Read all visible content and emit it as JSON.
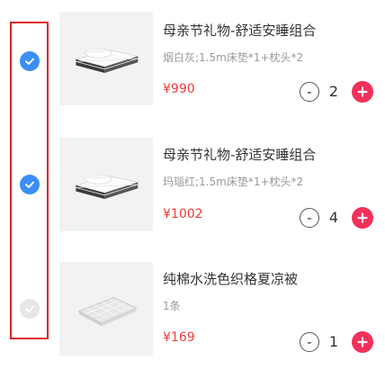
{
  "colors": {
    "accent_check": "#3a8ef6",
    "price": "#f23a3a",
    "plus_button": "#f2305a",
    "highlight_border": "#e02020"
  },
  "icons": {
    "check": "check-icon",
    "minus": "minus-icon",
    "plus": "plus-icon"
  },
  "cart": {
    "items": [
      {
        "title": "母亲节礼物-舒适安睡组合",
        "spec": "烟白灰;1.5m床垫*1+枕头*2",
        "price": "¥990",
        "quantity": "2",
        "minus_label": "-",
        "selected": true
      },
      {
        "title": "母亲节礼物-舒适安睡组合",
        "spec": "玛瑙红;1.5m床垫*1+枕头*2",
        "price": "¥1002",
        "quantity": "4",
        "minus_label": "-",
        "selected": true
      },
      {
        "title": "纯棉水洗色织格夏凉被",
        "spec": "1条",
        "price": "¥169",
        "quantity": "1",
        "minus_label": "-",
        "selected": false
      }
    ]
  }
}
